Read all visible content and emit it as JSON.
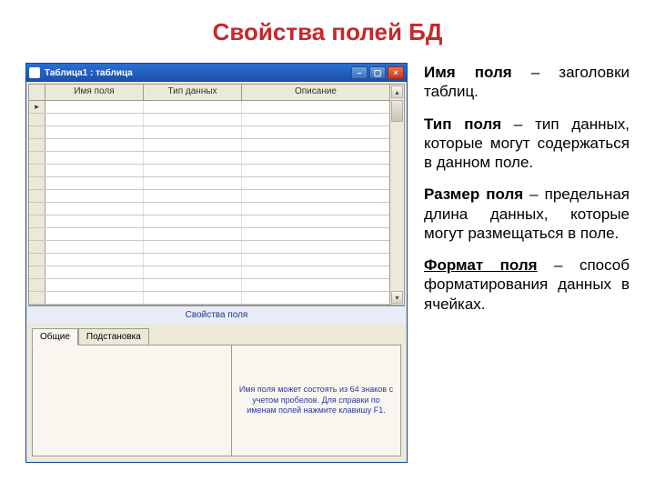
{
  "title": "Свойства полей БД",
  "app": {
    "window_title": "Таблица1 : таблица",
    "columns": {
      "c1": "Имя поля",
      "c2": "Тип данных",
      "c3": "Описание"
    },
    "section": "Свойства поля",
    "tabs": {
      "general": "Общие",
      "lookup": "Подстановка"
    },
    "hint": "Имя поля может состоять из 64 знаков с учетом пробелов. Для справки по именам полей нажмите клавишу F1."
  },
  "descr": {
    "p1": {
      "term": "Имя поля",
      "rest": " – заголовки таблиц."
    },
    "p2": {
      "term": "Тип поля",
      "rest": " – тип данных, которые могут содержаться в данном поле."
    },
    "p3": {
      "term": "Размер поля",
      "rest": " – предельная длина данных, которые могут размещаться в поле."
    },
    "p4": {
      "term": "Формат поля",
      "rest": " – способ форматирования данных в ячейках."
    }
  },
  "chart_data": {
    "type": "table",
    "columns": [
      "Имя поля",
      "Тип данных",
      "Описание"
    ],
    "rows": []
  }
}
